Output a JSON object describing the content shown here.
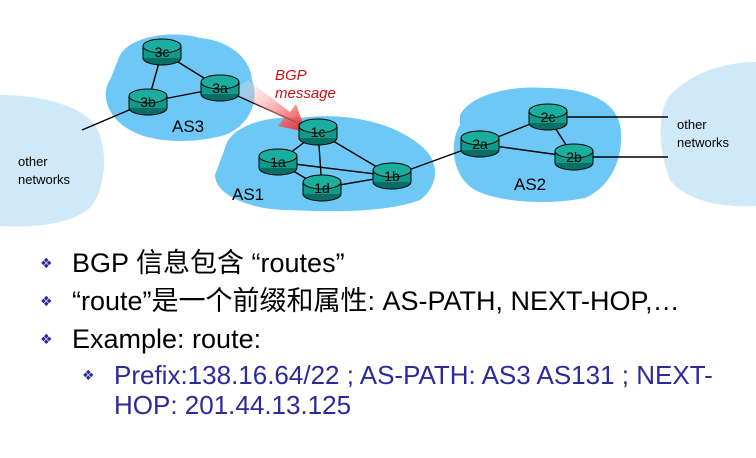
{
  "diagram": {
    "bgp_message_line1": "BGP",
    "bgp_message_line2": "message",
    "other_networks_left_line1": "other",
    "other_networks_left_line2": "networks",
    "other_networks_right_line1": "other",
    "other_networks_right_line2": "networks",
    "as_labels": {
      "as3": "AS3",
      "as1": "AS1",
      "as2": "AS2"
    },
    "routers": {
      "r3c": "3c",
      "r3b": "3b",
      "r3a": "3a",
      "r1c": "1c",
      "r1a": "1a",
      "r1d": "1d",
      "r1b": "1b",
      "r2a": "2a",
      "r2c": "2c",
      "r2b": "2b"
    },
    "colors": {
      "cloud": "#6ec8f5",
      "router": "#0f9a8c",
      "arrow": "#ee3333"
    }
  },
  "bullets": {
    "line1": "BGP 信息包含 “routes”",
    "line2": "“route”是一个前缀和属性: AS-PATH, NEXT-HOP,…",
    "line3": "Example: route:",
    "sub": "Prefix:138.16.64/22 ;  AS-PATH:  AS3  AS131 ;  NEXT-HOP:  201.44.13.125",
    "marker": "❖"
  }
}
